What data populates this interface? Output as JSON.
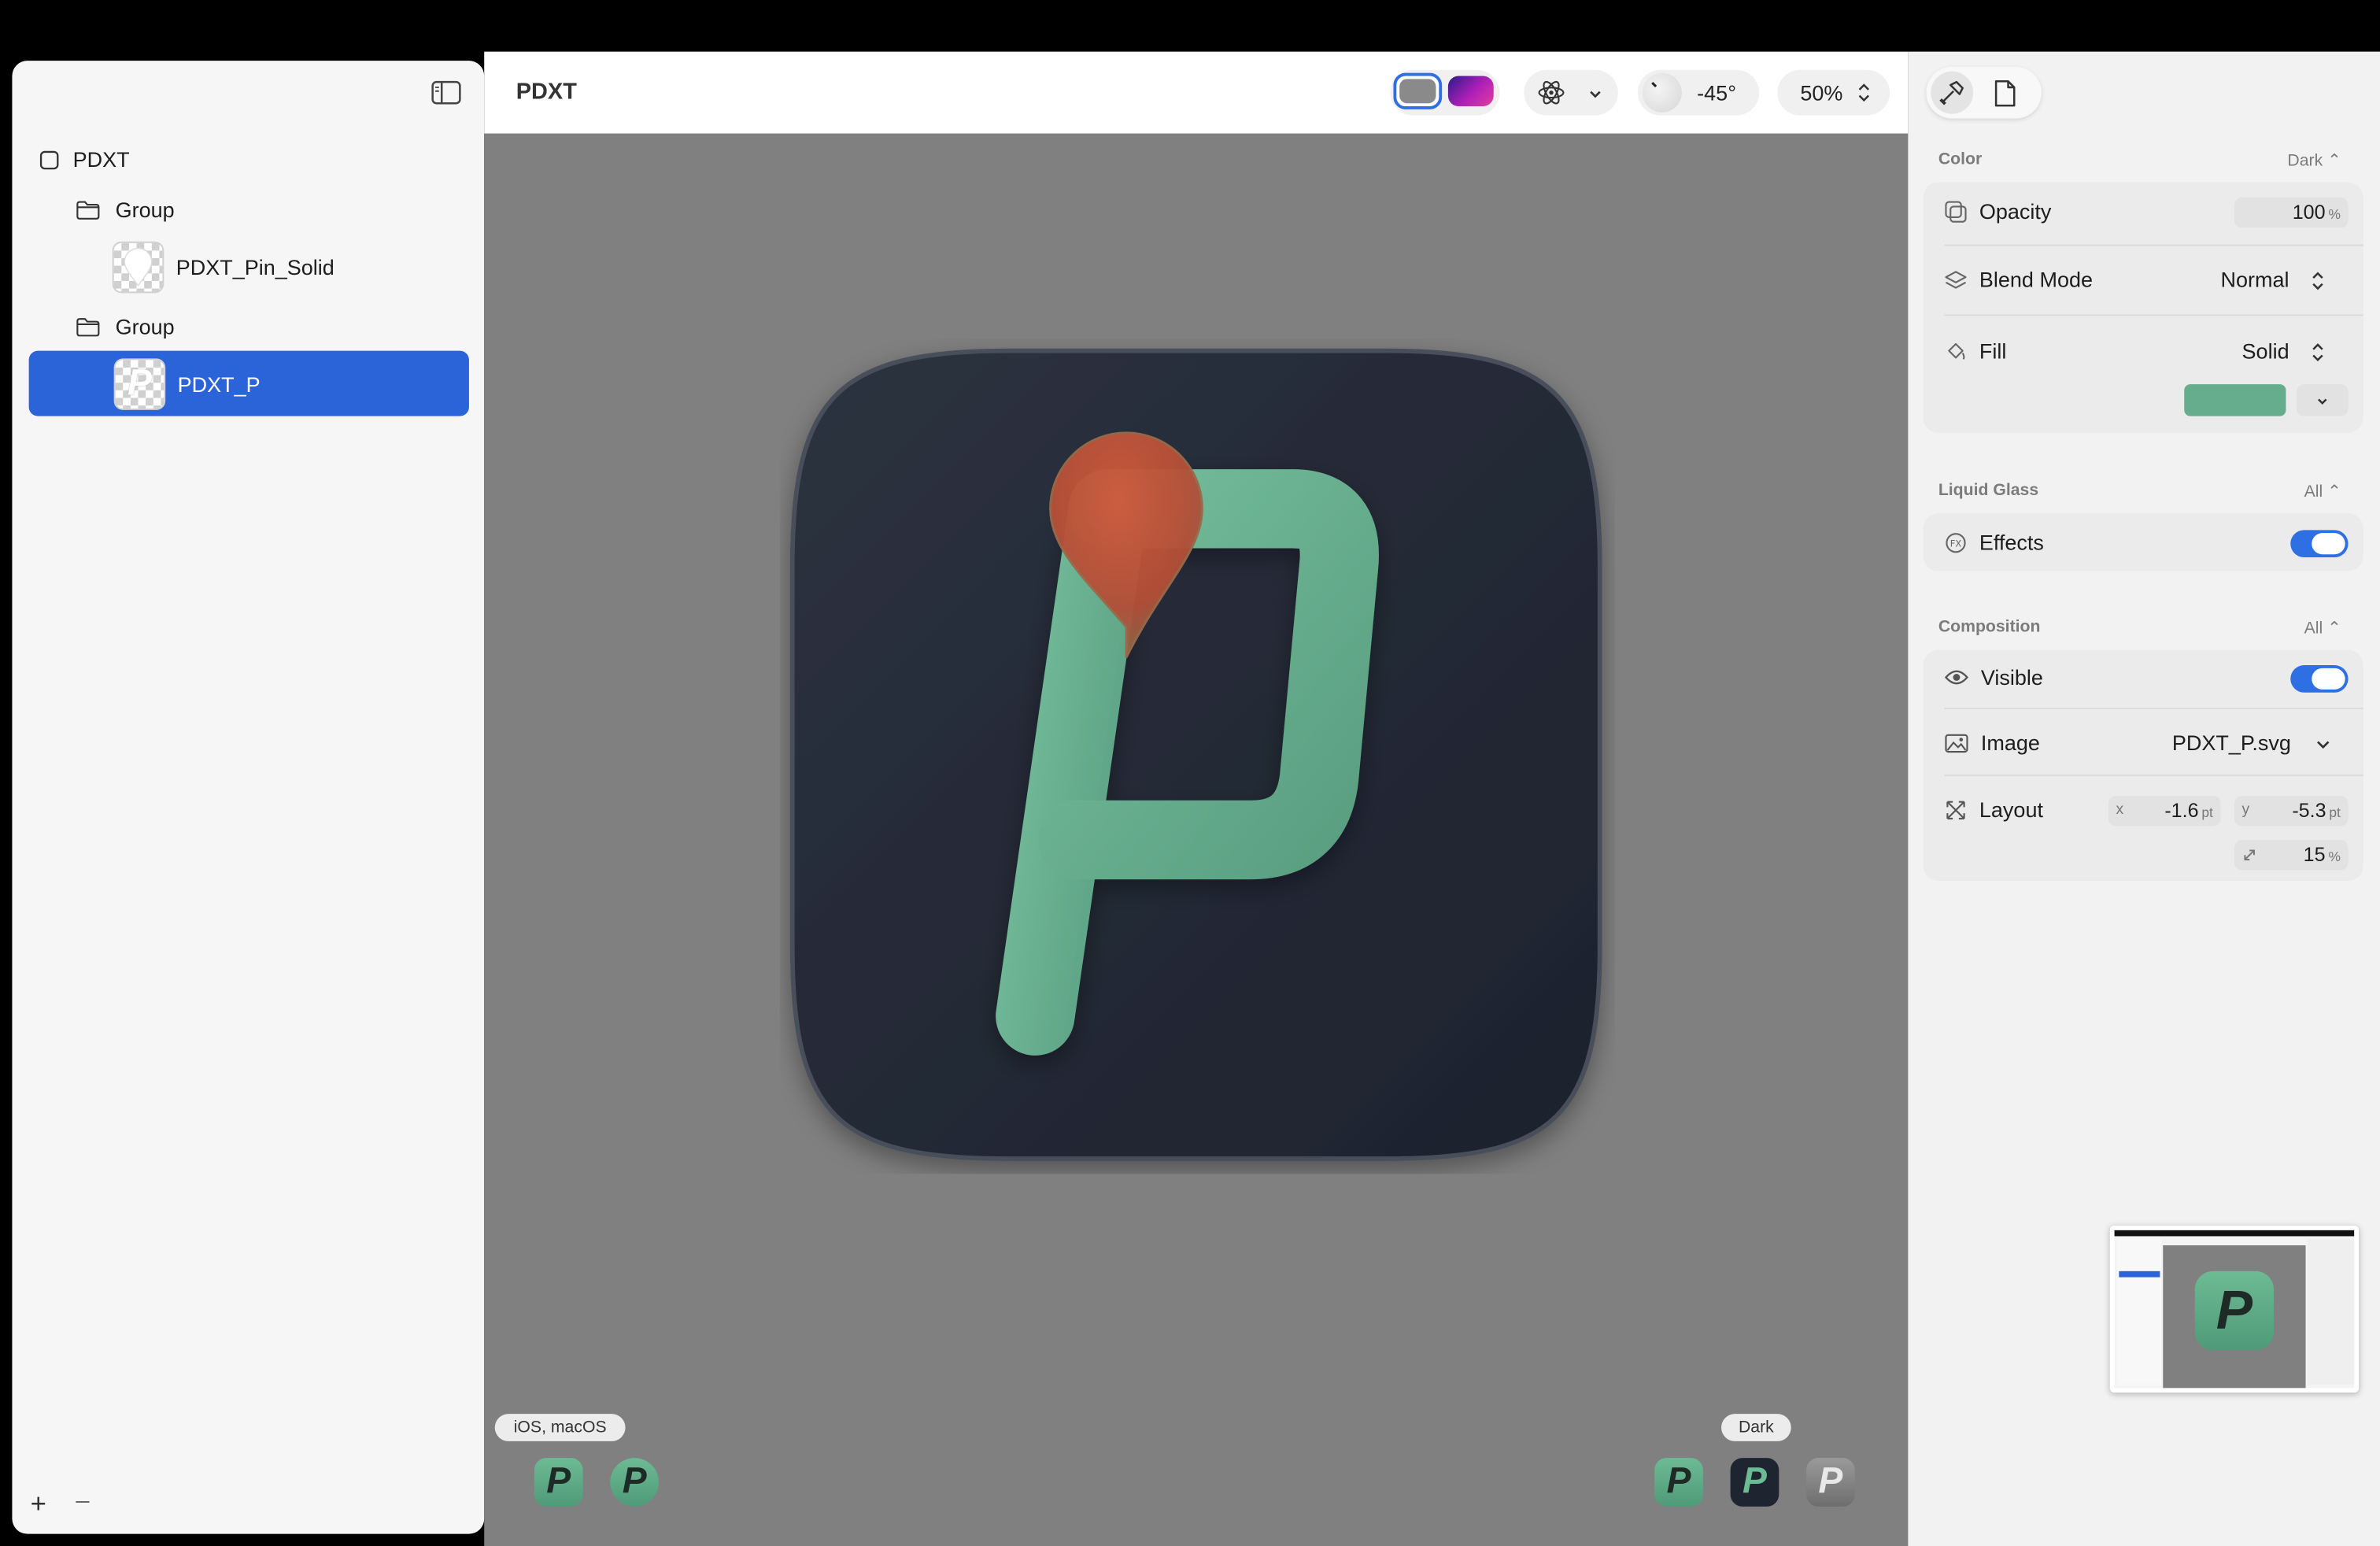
{
  "layers": {
    "root": "PDXT",
    "group1": "Group",
    "pin_layer": "PDXT_Pin_Solid",
    "group2": "Group",
    "p_layer": "PDXT_P"
  },
  "footer": {
    "add": "+",
    "remove": "–"
  },
  "canvas": {
    "title": "PDXT",
    "angle": "-45°",
    "zoom": "50%",
    "platform_label": "iOS, macOS",
    "appearance_label": "Dark"
  },
  "inspector": {
    "color": {
      "title": "Color",
      "scope": "Dark",
      "opacity_label": "Opacity",
      "opacity_value": "100",
      "opacity_unit": "%",
      "blend_label": "Blend Mode",
      "blend_value": "Normal",
      "fill_label": "Fill",
      "fill_value": "Solid",
      "fill_color": "#65ad8d"
    },
    "liquid_glass": {
      "title": "Liquid Glass",
      "scope": "All",
      "effects_label": "Effects",
      "effects_on": true
    },
    "composition": {
      "title": "Composition",
      "scope": "All",
      "visible_label": "Visible",
      "visible_on": true,
      "image_label": "Image",
      "image_value": "PDXT_P.svg",
      "layout_label": "Layout",
      "x_prefix": "x",
      "x_value": "-1.6",
      "y_prefix": "y",
      "y_value": "-5.3",
      "unit_pt": "pt",
      "scale_value": "15",
      "scale_unit": "%"
    }
  },
  "colors": {
    "accent": "#2f6fe4",
    "icon_bg": "#242a36",
    "p_green": "#65ad8d",
    "pin_red": "#c4543a",
    "canvas_gray": "#808080"
  }
}
